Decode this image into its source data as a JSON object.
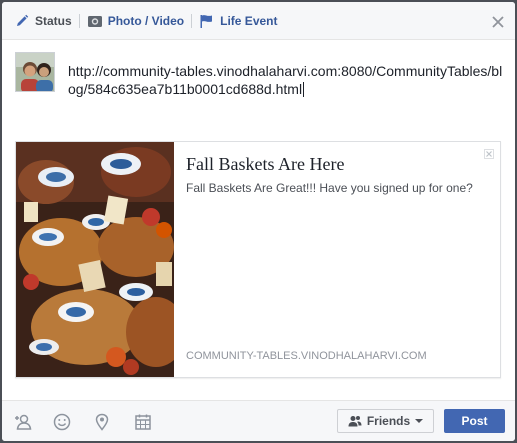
{
  "tabs": {
    "status": "Status",
    "photo_video": "Photo / Video",
    "life_event": "Life Event"
  },
  "status_text": "http://community-tables.vinodhalaharvi.com:8080/CommunityTables/blog/584c635ea7b11b0001cd688d.html",
  "link_preview": {
    "title": "Fall Baskets Are Here",
    "description": "Fall Baskets Are Great!!! Have you signed up for one?",
    "domain": "COMMUNITY-TABLES.VINODHALAHARVI.COM"
  },
  "footer": {
    "audience_label": "Friends",
    "post_label": "Post"
  },
  "icons": {
    "status": "pencil-icon",
    "photo": "camera-icon",
    "life_event": "flag-icon",
    "close": "close-icon",
    "tag": "tag-people-icon",
    "feeling": "smiley-icon",
    "location": "location-pin-icon",
    "date": "calendar-icon"
  },
  "colors": {
    "accent": "#4267b2",
    "link": "#365899",
    "header_bg": "#f6f7f9"
  }
}
